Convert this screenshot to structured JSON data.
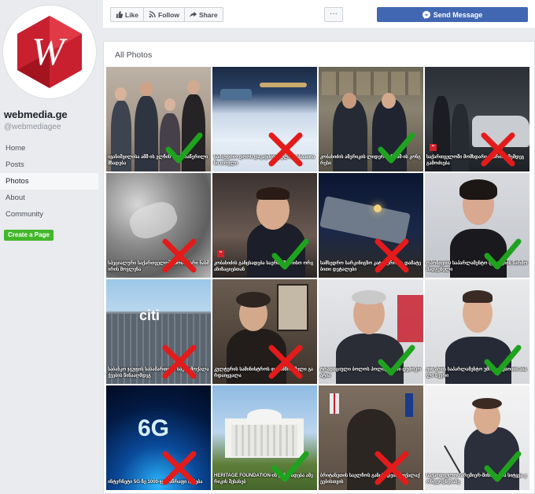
{
  "sidebar": {
    "page_name": "webmedia.ge",
    "page_handle": "@webmediagee",
    "nav": [
      {
        "label": "Home",
        "active": false
      },
      {
        "label": "Posts",
        "active": false
      },
      {
        "label": "Photos",
        "active": true
      },
      {
        "label": "About",
        "active": false
      },
      {
        "label": "Community",
        "active": false
      }
    ],
    "create_label": "Create a Page"
  },
  "toolbar": {
    "like_label": "Like",
    "follow_label": "Follow",
    "share_label": "Share",
    "more_label": "···",
    "send_label": "Send Message"
  },
  "photos": {
    "title": "All Photos",
    "items": [
      {
        "caption": "ივანიშვილისა ამშ-ის ელჩის მიერ ჩაწერილი მზადება",
        "mark": "check"
      },
      {
        "caption": "სამხედრო დროს დაკავშირებული 27-საათიანი თოვლი",
        "mark": "cross"
      },
      {
        "caption": "კობახიძის ამერიკის ლიდერთან ამშ-ის კონგრესი",
        "mark": "check"
      },
      {
        "caption": "საქართველოში მომხდარი ავარიის შემდეგ გამოძიება",
        "mark": "cross"
      },
      {
        "caption": "სპეციალური საქართველოში მომხდარი ნახშირის მოვლენა",
        "mark": "cross"
      },
      {
        "caption": "კობახიძის განცხადება საერთაშორისო ორგანიზაციებთან",
        "mark": "check"
      },
      {
        "caption": "სამხედრო სარკინიგზო კატასტროფა დამატებითი დეტალები",
        "mark": "cross"
      },
      {
        "caption": "ოპოზიციის საპარლამენტო ფრაქციის წარმომადგენელი",
        "mark": "check"
      },
      {
        "caption": "საბანკო ჯგუფის სასამართლო საქმე მოქალაქეების წინააღმდეგ",
        "mark": "cross"
      },
      {
        "caption": "კულტურის სამინისტროს თანამშრომელი გარდაიცვალა",
        "mark": "cross"
      },
      {
        "caption": "ტრადიციული ბოლოს პოლიტიკური დემოკრატია",
        "mark": "check"
      },
      {
        "caption": "ვინ არის საპარლამენტო უმრავლესობის ახალი წევრი",
        "mark": "check"
      },
      {
        "caption": "ინტერნეტი 5G-ზე 1000-ჯერ სწრაფი იქნება",
        "mark": "cross"
      },
      {
        "caption": "HERITAGE FOUNDATION-ის განცხადება ამერიკის შესახებ",
        "mark": "check"
      },
      {
        "caption": "ბრიტანეთის საელჩოს განცხადება მოქალაქეებისთვის",
        "mark": "cross"
      },
      {
        "caption": "საქართველოს პრემიერ-მინისტრის სიტყვა კონფერენციაზე",
        "mark": "check"
      }
    ]
  },
  "colors": {
    "accent": "#4267b2",
    "create": "#42b72a",
    "check": "#1fa31f",
    "cross": "#e31b1b"
  }
}
